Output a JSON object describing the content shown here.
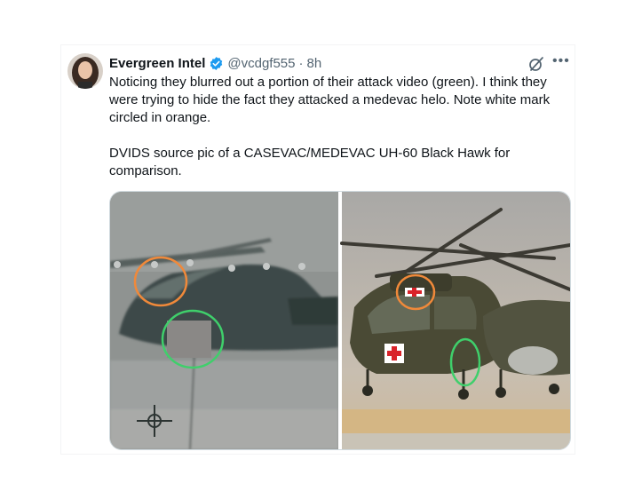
{
  "tweet": {
    "display_name": "Evergreen Intel",
    "handle": "@vcdgf555",
    "separator": "·",
    "time": "8h",
    "more_label": "•••",
    "paragraph1": "Noticing they blurred out a portion of their attack video (green). I think they were trying to hide the fact they attacked a medevac helo. Note white mark circled in orange.",
    "paragraph2": "DVIDS source pic of a CASEVAC/MEDEVAC UH-60 Black Hawk for comparison."
  },
  "icons": {
    "verified": "verified-badge-icon",
    "grok": "grok-icon",
    "more": "more-icon"
  },
  "colors": {
    "verified_blue": "#1d9bf0",
    "text_primary": "#0f1419",
    "text_secondary": "#536471",
    "orange_circle": "#f0893a",
    "green_circle": "#3fcf6b",
    "medical_red": "#d9232a"
  },
  "media": {
    "left_image": "blurred helicopter video frame",
    "right_image": "UH-60 Black Hawk medevac photo"
  }
}
